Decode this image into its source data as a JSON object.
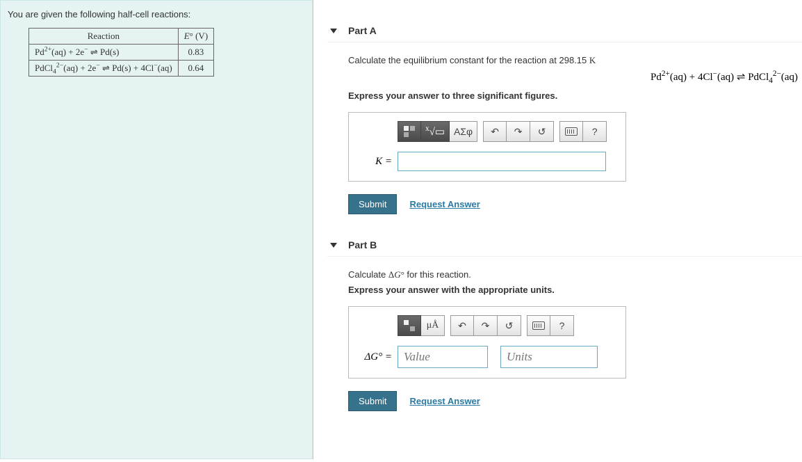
{
  "left": {
    "intro": "You are given the following half-cell reactions:",
    "table": {
      "headers": {
        "reaction": "Reaction",
        "e": "E° (V)"
      },
      "rows": [
        {
          "reaction": "Pd²⁺(aq) + 2e⁻ ⇌ Pd(s)",
          "e": "0.83"
        },
        {
          "reaction": "PdCl₄²⁻(aq) + 2e⁻ ⇌ Pd(s) + 4Cl⁻(aq)",
          "e": "0.64"
        }
      ]
    }
  },
  "partA": {
    "title": "Part A",
    "prompt": "Calculate the equilibrium constant for the reaction at 298.15 K",
    "equation": "Pd²⁺(aq) + 4Cl⁻(aq) ⇌ PdCl₄²⁻(aq)",
    "instruction": "Express your answer to three significant figures.",
    "toolbar": {
      "templates": "templates-icon",
      "sqrt": "x√□",
      "greek": "ΑΣφ",
      "undo": "↶",
      "redo": "↷",
      "reset": "↺",
      "keyboard": "keyboard",
      "help": "?"
    },
    "answer_label": "K =",
    "answer_value": "",
    "submit": "Submit",
    "request": "Request Answer"
  },
  "partB": {
    "title": "Part B",
    "prompt": "Calculate ΔG° for this reaction.",
    "instruction": "Express your answer with the appropriate units.",
    "toolbar": {
      "templates": "templates-icon",
      "units": "μÅ",
      "undo": "↶",
      "redo": "↷",
      "reset": "↺",
      "keyboard": "keyboard",
      "help": "?"
    },
    "answer_label": "ΔG° =",
    "value_placeholder": "Value",
    "units_placeholder": "Units",
    "submit": "Submit",
    "request": "Request Answer"
  }
}
